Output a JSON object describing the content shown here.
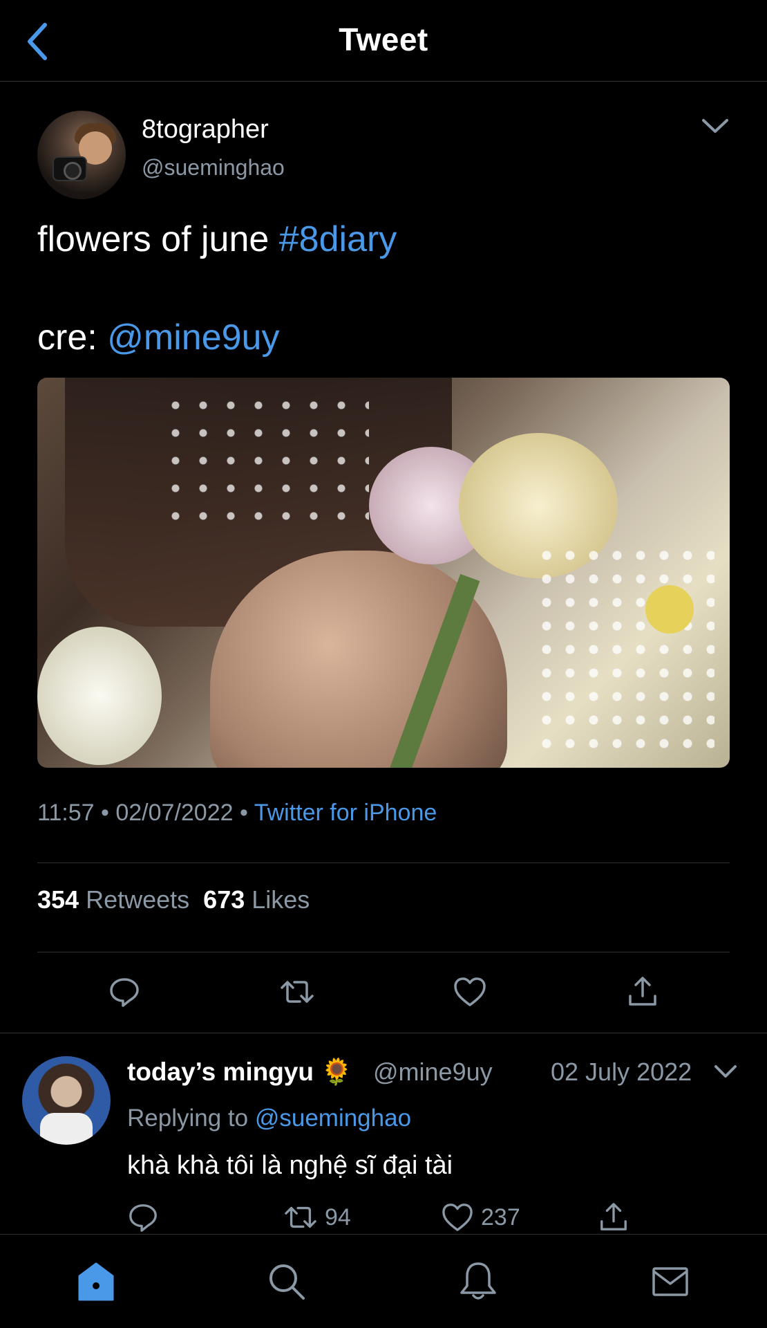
{
  "header": {
    "title": "Tweet"
  },
  "tweet": {
    "display_name": "8tographer",
    "handle": "@sueminghao",
    "text_line1": "flowers of june ",
    "hashtag": "#8diary",
    "text_line2": "cre: ",
    "mention": "@mine9uy",
    "meta_time": "11:57 • 02/07/2022 • ",
    "source": "Twitter for iPhone",
    "retweets_count": "354",
    "retweets_label": " Retweets",
    "likes_count": "673",
    "likes_label": " Likes"
  },
  "reply": {
    "display_name": "today’s mingyu",
    "emoji": "🌻",
    "handle": "@mine9uy",
    "date": "02 July 2022",
    "replying_prefix": "Replying to ",
    "replying_to": "@sueminghao",
    "text": "khà khà tôi là nghệ sĩ đại tài",
    "retweets": "94",
    "likes": "237"
  },
  "colors": {
    "accent": "#4a99e9",
    "muted": "#8b98a5",
    "divider": "#2f3336",
    "background": "#000000"
  },
  "icons": [
    "chevron-left-icon",
    "chevron-down-icon",
    "reply-icon",
    "retweet-icon",
    "like-icon",
    "share-icon",
    "home-icon",
    "search-icon",
    "notifications-icon",
    "messages-icon"
  ]
}
